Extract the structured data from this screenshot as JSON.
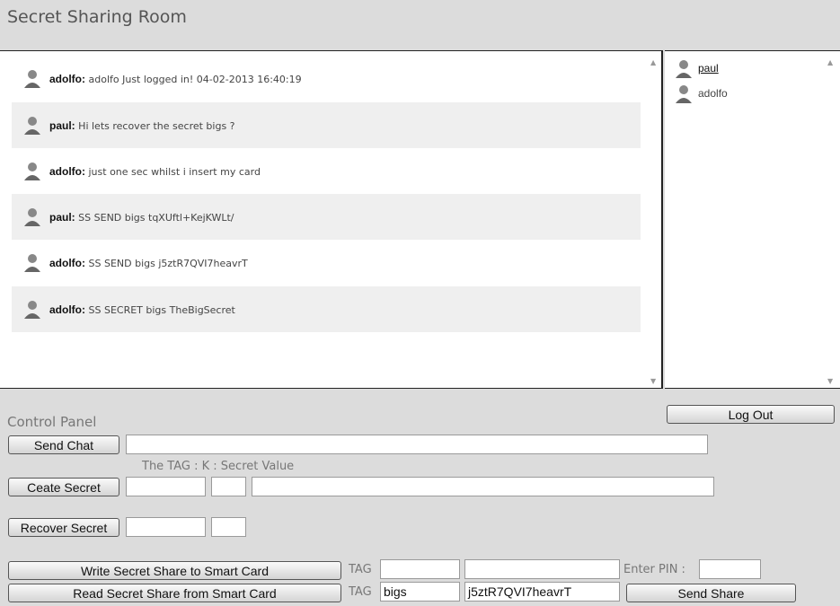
{
  "title": "Secret Sharing Room",
  "messages": [
    {
      "user": "adolfo:",
      "text": "adolfo Just logged in! 04-02-2013 16:40:19"
    },
    {
      "user": "paul:",
      "text": "Hi lets recover the secret bigs ?"
    },
    {
      "user": "adolfo:",
      "text": "just one sec whilst i insert my card"
    },
    {
      "user": "paul:",
      "text": "SS SEND bigs tqXUftl+KejKWLt/"
    },
    {
      "user": "adolfo:",
      "text": "SS SEND bigs j5ztR7QVI7heavrT"
    },
    {
      "user": "adolfo:",
      "text": "SS SECRET bigs TheBigSecret"
    }
  ],
  "users": [
    {
      "name": "paul"
    },
    {
      "name": "adolfo"
    }
  ],
  "control": {
    "heading": "Control Panel",
    "logout": "Log Out",
    "send_chat": "Send Chat",
    "chat_value": "",
    "hint": "The TAG : K : Secret Value",
    "create_secret": "Ceate Secret",
    "recover_secret": "Recover Secret",
    "write_card": "Write Secret Share to Smart Card",
    "read_card": "Read Secret Share from Smart Card",
    "tag_label": "TAG",
    "pin_label": "Enter PIN :",
    "send_share": "Send Share",
    "read_tag_value": "bigs",
    "read_share_value": "j5ztR7QVI7heavrT"
  },
  "icons": {
    "avatar": "user-avatar-icon",
    "scroll_up": "scroll-up-arrow",
    "scroll_down": "scroll-down-arrow"
  }
}
